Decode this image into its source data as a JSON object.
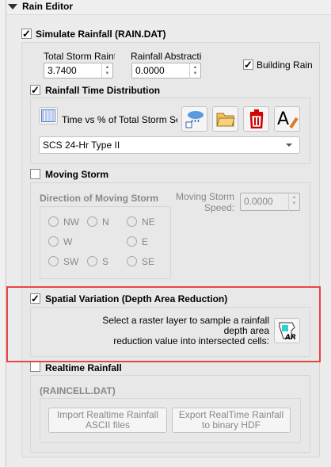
{
  "header": {
    "title": "Rain Editor",
    "expanded": true
  },
  "simulate": {
    "label": "Simulate Rainfall  (RAIN.DAT)",
    "checked": true,
    "total_storm_label": "Total Storm Rainfa",
    "total_storm_value": "3.7400",
    "abstraction_label": "Rainfall Abstractio",
    "abstraction_value": "0.0000",
    "building_rain_label": "Building Rain",
    "building_rain_checked": true
  },
  "time_distribution": {
    "label": "Rainfall Time Distribution",
    "checked": true,
    "series_label": "Time vs % of Total Storm Serie",
    "combo_value": "SCS 24-Hr Type II"
  },
  "moving_storm": {
    "label": "Moving Storm",
    "checked": false,
    "direction_label": "Direction of Moving Storm",
    "directions": [
      "NW",
      "N",
      "NE",
      "W",
      "E",
      "SW",
      "S",
      "SE"
    ],
    "speed_label_1": "Moving Storm",
    "speed_label_2": "Speed:",
    "speed_value": "0.0000"
  },
  "spatial": {
    "label": "Spatial Variation (Depth Area Reduction)",
    "checked": true,
    "desc_1": "Select a raster layer to sample a rainfall depth area",
    "desc_2": "reduction value into intersected cells:",
    "button_icon_text": "AR"
  },
  "realtime": {
    "label": "Realtime Rainfall",
    "checked": false,
    "file_label": "(RAINCELL.DAT)",
    "import_1": "Import Realtime Rainfall",
    "import_2": "ASCII files",
    "export_1": "Export RealTime Rainfall",
    "export_2": "to binary HDF"
  },
  "colors": {
    "highlight": "#e84545",
    "accent": "#d40000"
  }
}
